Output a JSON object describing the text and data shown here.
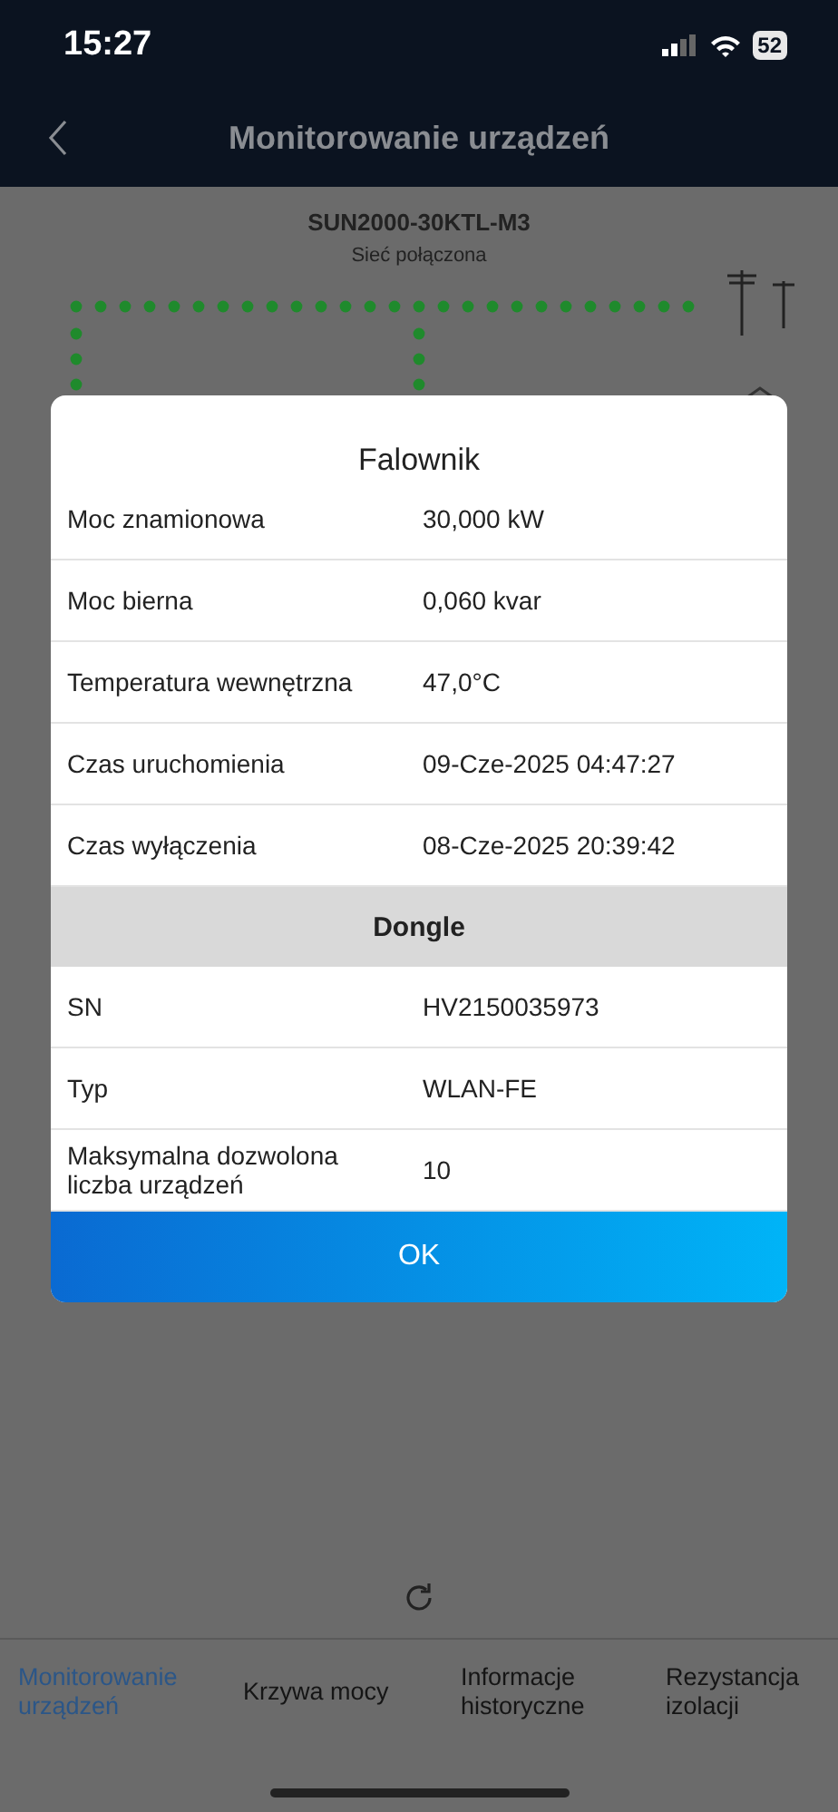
{
  "status_bar": {
    "time": "15:27",
    "battery": "52"
  },
  "header": {
    "title": "Monitorowanie urządzeń"
  },
  "device": {
    "model": "SUN2000-30KTL-M3",
    "status": "Sieć połączona"
  },
  "dialog": {
    "title": "Falownik",
    "rows": [
      {
        "label": "Moc znamionowa",
        "value": "30,000 kW"
      },
      {
        "label": "Moc bierna",
        "value": "0,060 kvar"
      },
      {
        "label": "Temperatura wewnętrzna",
        "value": "47,0°C"
      },
      {
        "label": "Czas uruchomienia",
        "value": "09-Cze-2025 04:47:27"
      },
      {
        "label": "Czas wyłączenia",
        "value": "08-Cze-2025 20:39:42"
      }
    ],
    "sections": [
      {
        "title": "Dongle",
        "rows": [
          {
            "label": "SN",
            "value": "HV2150035973"
          },
          {
            "label": "Typ",
            "value": "WLAN-FE"
          },
          {
            "label": "Maksymalna dozwolona liczba urządzeń",
            "value": "10"
          }
        ]
      }
    ],
    "button": "OK"
  },
  "tabs": [
    {
      "label": "Monitorowanie urządzeń",
      "selected": true
    },
    {
      "label": "Krzywa mocy",
      "selected": false
    },
    {
      "label": "Informacje historyczne",
      "selected": false
    },
    {
      "label": "Rezystancja izolacji",
      "selected": false
    }
  ]
}
